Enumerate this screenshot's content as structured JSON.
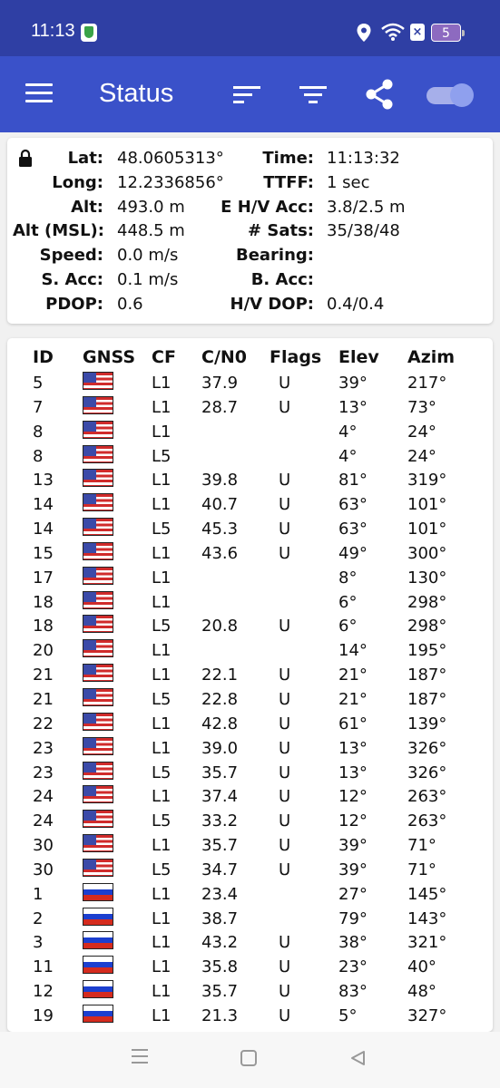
{
  "status_bar": {
    "time": "11:13",
    "battery": "5"
  },
  "app_bar": {
    "title": "Status",
    "icons": [
      "menu-icon",
      "sort-icon",
      "filter-icon",
      "share-icon",
      "toggle-switch"
    ],
    "toggle_on": true
  },
  "fix_info": {
    "left": [
      {
        "label": "Lat:",
        "value": "48.0605313°"
      },
      {
        "label": "Long:",
        "value": "12.2336856°"
      },
      {
        "label": "Alt:",
        "value": "493.0 m"
      },
      {
        "label": "Alt (MSL):",
        "value": "448.5 m"
      },
      {
        "label": "Speed:",
        "value": "0.0 m/s"
      },
      {
        "label": "S. Acc:",
        "value": "0.1 m/s"
      },
      {
        "label": "PDOP:",
        "value": "0.6"
      }
    ],
    "right": [
      {
        "label": "Time:",
        "value": "11:13:32"
      },
      {
        "label": "TTFF:",
        "value": "1 sec"
      },
      {
        "label": "E H/V Acc:",
        "value": "3.8/2.5 m"
      },
      {
        "label": "# Sats:",
        "value": "35/38/48"
      },
      {
        "label": "Bearing:",
        "value": ""
      },
      {
        "label": "B. Acc:",
        "value": ""
      },
      {
        "label": "H/V DOP:",
        "value": "0.4/0.4"
      }
    ]
  },
  "table": {
    "headers": {
      "id": "ID",
      "gnss": "GNSS",
      "cf": "CF",
      "cn0": "C/N0",
      "flags": "Flags",
      "elev": "Elev",
      "azim": "Azim"
    },
    "rows": [
      {
        "id": "5",
        "gnss": "us",
        "cf": "L1",
        "cn0": "37.9",
        "flags": "U",
        "elev": "39°",
        "azim": "217°"
      },
      {
        "id": "7",
        "gnss": "us",
        "cf": "L1",
        "cn0": "28.7",
        "flags": "U",
        "elev": "13°",
        "azim": "73°"
      },
      {
        "id": "8",
        "gnss": "us",
        "cf": "L1",
        "cn0": "",
        "flags": "",
        "elev": "4°",
        "azim": "24°"
      },
      {
        "id": "8",
        "gnss": "us",
        "cf": "L5",
        "cn0": "",
        "flags": "",
        "elev": "4°",
        "azim": "24°"
      },
      {
        "id": "13",
        "gnss": "us",
        "cf": "L1",
        "cn0": "39.8",
        "flags": "U",
        "elev": "81°",
        "azim": "319°"
      },
      {
        "id": "14",
        "gnss": "us",
        "cf": "L1",
        "cn0": "40.7",
        "flags": "U",
        "elev": "63°",
        "azim": "101°"
      },
      {
        "id": "14",
        "gnss": "us",
        "cf": "L5",
        "cn0": "45.3",
        "flags": "U",
        "elev": "63°",
        "azim": "101°"
      },
      {
        "id": "15",
        "gnss": "us",
        "cf": "L1",
        "cn0": "43.6",
        "flags": "U",
        "elev": "49°",
        "azim": "300°"
      },
      {
        "id": "17",
        "gnss": "us",
        "cf": "L1",
        "cn0": "",
        "flags": "",
        "elev": "8°",
        "azim": "130°"
      },
      {
        "id": "18",
        "gnss": "us",
        "cf": "L1",
        "cn0": "",
        "flags": "",
        "elev": "6°",
        "azim": "298°"
      },
      {
        "id": "18",
        "gnss": "us",
        "cf": "L5",
        "cn0": "20.8",
        "flags": "U",
        "elev": "6°",
        "azim": "298°"
      },
      {
        "id": "20",
        "gnss": "us",
        "cf": "L1",
        "cn0": "",
        "flags": "",
        "elev": "14°",
        "azim": "195°"
      },
      {
        "id": "21",
        "gnss": "us",
        "cf": "L1",
        "cn0": "22.1",
        "flags": "U",
        "elev": "21°",
        "azim": "187°"
      },
      {
        "id": "21",
        "gnss": "us",
        "cf": "L5",
        "cn0": "22.8",
        "flags": "U",
        "elev": "21°",
        "azim": "187°"
      },
      {
        "id": "22",
        "gnss": "us",
        "cf": "L1",
        "cn0": "42.8",
        "flags": "U",
        "elev": "61°",
        "azim": "139°"
      },
      {
        "id": "23",
        "gnss": "us",
        "cf": "L1",
        "cn0": "39.0",
        "flags": "U",
        "elev": "13°",
        "azim": "326°"
      },
      {
        "id": "23",
        "gnss": "us",
        "cf": "L5",
        "cn0": "35.7",
        "flags": "U",
        "elev": "13°",
        "azim": "326°"
      },
      {
        "id": "24",
        "gnss": "us",
        "cf": "L1",
        "cn0": "37.4",
        "flags": "U",
        "elev": "12°",
        "azim": "263°"
      },
      {
        "id": "24",
        "gnss": "us",
        "cf": "L5",
        "cn0": "33.2",
        "flags": "U",
        "elev": "12°",
        "azim": "263°"
      },
      {
        "id": "30",
        "gnss": "us",
        "cf": "L1",
        "cn0": "35.7",
        "flags": "U",
        "elev": "39°",
        "azim": "71°"
      },
      {
        "id": "30",
        "gnss": "us",
        "cf": "L5",
        "cn0": "34.7",
        "flags": "U",
        "elev": "39°",
        "azim": "71°"
      },
      {
        "id": "1",
        "gnss": "ru",
        "cf": "L1",
        "cn0": "23.4",
        "flags": "",
        "elev": "27°",
        "azim": "145°"
      },
      {
        "id": "2",
        "gnss": "ru",
        "cf": "L1",
        "cn0": "38.7",
        "flags": "",
        "elev": "79°",
        "azim": "143°"
      },
      {
        "id": "3",
        "gnss": "ru",
        "cf": "L1",
        "cn0": "43.2",
        "flags": "U",
        "elev": "38°",
        "azim": "321°"
      },
      {
        "id": "11",
        "gnss": "ru",
        "cf": "L1",
        "cn0": "35.8",
        "flags": "U",
        "elev": "23°",
        "azim": "40°"
      },
      {
        "id": "12",
        "gnss": "ru",
        "cf": "L1",
        "cn0": "35.7",
        "flags": "U",
        "elev": "83°",
        "azim": "48°"
      },
      {
        "id": "19",
        "gnss": "ru",
        "cf": "L1",
        "cn0": "21.3",
        "flags": "U",
        "elev": "5°",
        "azim": "327°"
      }
    ]
  },
  "colors": {
    "status_bar": "#2f3fa4",
    "app_bar": "#3a51c9",
    "toggle": "#8fa0ee"
  }
}
